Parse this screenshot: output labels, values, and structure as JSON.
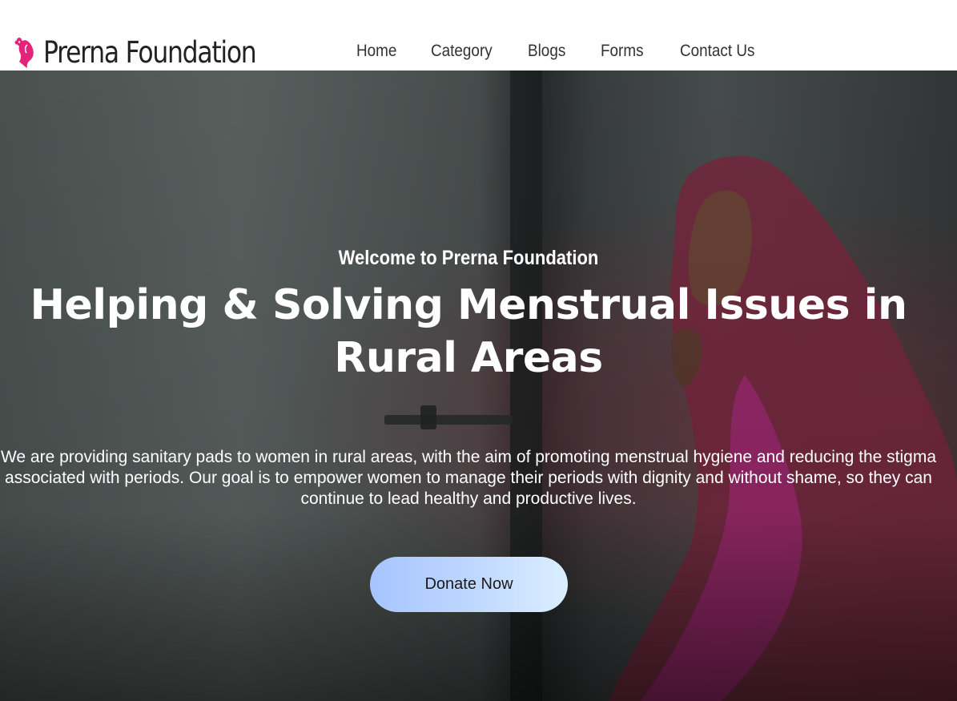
{
  "header": {
    "brand": "Prerna Foundation",
    "nav": [
      {
        "label": "Home"
      },
      {
        "label": "Category"
      },
      {
        "label": "Blogs"
      },
      {
        "label": "Forms"
      },
      {
        "label": "Contact Us"
      }
    ]
  },
  "hero": {
    "subtitle": "Welcome to Prerna Foundation",
    "headline": "Helping & Solving Menstrual Issues in Rural Areas",
    "description": "We are providing sanitary pads to women in rural areas, with the aim of promoting menstrual hygiene and reducing the stigma associated with periods. Our goal is to empower women to manage their periods with dignity and without shame, so they can continue to lead healthy and productive lives.",
    "cta_label": "Donate Now",
    "background": "photo of a woman in a pink and red sari and head scarf sitting by a concrete wall"
  },
  "colors": {
    "brand_pink": "#e4237a",
    "button_gradient_start": "#a6c4ff",
    "button_gradient_end": "#dbeeff",
    "text_dark": "#222222"
  },
  "icons": {
    "logo": "woman-silhouette-flower-icon"
  }
}
